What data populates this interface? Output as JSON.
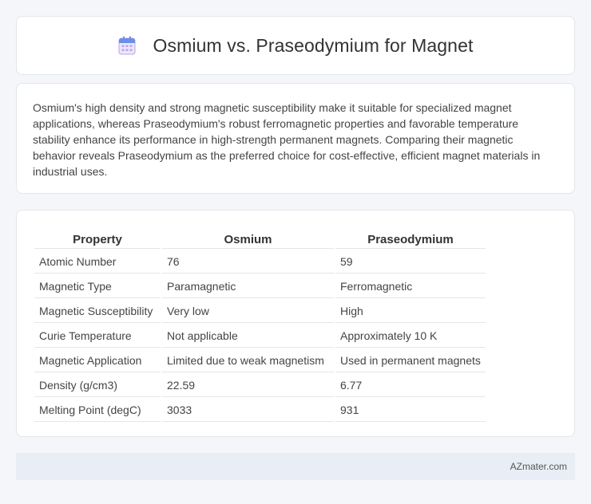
{
  "header": {
    "title": "Osmium vs. Praseodymium for Magnet",
    "icon": "calendar-icon"
  },
  "summary": {
    "text": "Osmium's high density and strong magnetic susceptibility make it suitable for specialized magnet applications, whereas Praseodymium's robust ferromagnetic properties and favorable temperature stability enhance its performance in high-strength permanent magnets. Comparing their magnetic behavior reveals Praseodymium as the preferred choice for cost-effective, efficient magnet materials in industrial uses."
  },
  "table": {
    "headers": [
      "Property",
      "Osmium",
      "Praseodymium"
    ],
    "rows": [
      [
        "Atomic Number",
        "76",
        "59"
      ],
      [
        "Magnetic Type",
        "Paramagnetic",
        "Ferromagnetic"
      ],
      [
        "Magnetic Susceptibility",
        "Very low",
        "High"
      ],
      [
        "Curie Temperature",
        "Not applicable",
        "Approximately 10 K"
      ],
      [
        "Magnetic Application",
        "Limited due to weak magnetism",
        "Used in permanent magnets"
      ],
      [
        "Density (g/cm3)",
        "22.59",
        "6.77"
      ],
      [
        "Melting Point (degC)",
        "3033",
        "931"
      ]
    ]
  },
  "footer": {
    "text": "AZmater.com"
  },
  "colors": {
    "icon_top": "#6c8ee8",
    "icon_body": "#b9a4e8",
    "footer_bg": "#e9eef6"
  }
}
